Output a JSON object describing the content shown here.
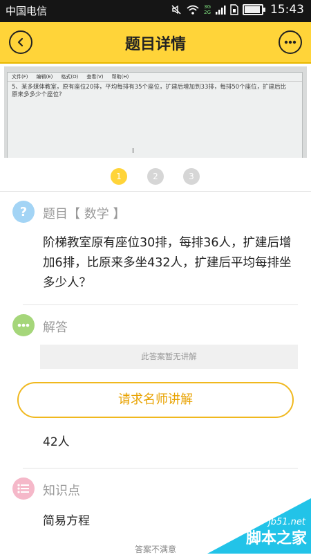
{
  "status_bar": {
    "carrier": "中国电信",
    "network": "3G",
    "network2": "2G",
    "time": "15:43",
    "battery_level": 0.85,
    "icons": [
      "mute-icon",
      "wifi-icon",
      "signal-icon",
      "sim-icon",
      "battery-icon"
    ]
  },
  "header": {
    "title": "题目详情",
    "back_icon": "chevron-left-icon",
    "more_icon": "ellipsis-icon",
    "accent_color": "#ffd439"
  },
  "photo": {
    "menu_items": [
      "文件(F)",
      "编辑(E)",
      "格式(O)",
      "查看(V)",
      "帮助(H)"
    ],
    "text": "5、某多媒体教室，原有座位20排，平均每排有35个座位，扩建后增加到33排，每排50个座位，扩建后比原来多多少个座位?"
  },
  "pager": {
    "pages": [
      "1",
      "2",
      "3"
    ],
    "active": "1"
  },
  "question_section": {
    "label": "题目【 数学 】",
    "icon": "question-icon",
    "icon_color": "#a3d4f5",
    "text": "阶梯教室原有座位30排，每排36人，扩建后增加6排，比原来多坐432人，扩建后平均每排坐多少人？"
  },
  "answer_section": {
    "label": "解答",
    "icon": "chat-icon",
    "icon_color": "#a5d67a",
    "no_explanation": "此答案暂无讲解",
    "request_button": "请求名师讲解",
    "answer": "42人"
  },
  "knowledge_section": {
    "label": "知识点",
    "icon": "list-icon",
    "icon_color": "#f5b8c9",
    "value": "简易方程"
  },
  "footer": {
    "text": "答案不满意"
  },
  "watermark": {
    "url": "jb51.net",
    "name": "脚本之家",
    "color": "#22c3e8"
  }
}
